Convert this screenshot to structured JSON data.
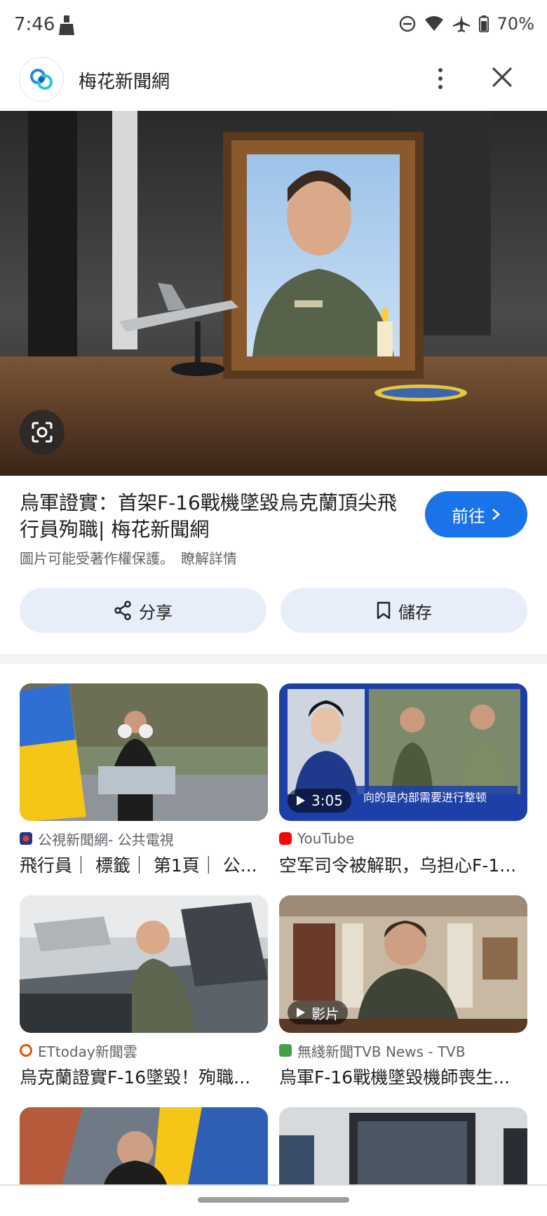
{
  "status_bar": {
    "time": "7:46",
    "battery": "70%",
    "icons": [
      "cleaning-icon",
      "do-not-disturb-icon",
      "wifi-icon",
      "airplane-icon",
      "battery-icon"
    ]
  },
  "header": {
    "site_name": "梅花新聞網",
    "logo_icon": "site-logo-icon",
    "more_icon": "more-vert-icon",
    "close_icon": "close-icon"
  },
  "hero": {
    "alt_subject": "portrait-in-frame"
  },
  "article": {
    "title": "烏軍證實：首架F-16戰機墜毀烏克蘭頂尖飛行員殉職| 梅花新聞網",
    "visit_label": "前往",
    "copyright_note": "圖片可能受著作權保護。",
    "learn_more": "瞭解詳情",
    "share_label": "分享",
    "save_label": "儲存"
  },
  "related": [
    {
      "source": "公視新聞網- 公共電視",
      "title": "飛行員｜ 標籤｜ 第1頁｜ 公...",
      "badge": null,
      "source_color": "#e53935"
    },
    {
      "source": "YouTube",
      "title": "空军司令被解职，乌担心F-1...",
      "badge": "3:05",
      "source_color": "#ff0000",
      "caption": "向的是内部需要进行整顿"
    },
    {
      "source": "ETtoday新聞雲",
      "title": "烏克蘭證實F-16墜毀！殉職...",
      "badge": null,
      "source_color": "#e65100"
    },
    {
      "source": "無綫新聞TVB News - TVB",
      "title": "烏軍F-16戰機墜毀機師喪生...",
      "badge": "影片",
      "source_color": "#43a047"
    }
  ],
  "colors": {
    "accent": "#1a73e8",
    "action_bg": "#e8eef9"
  }
}
